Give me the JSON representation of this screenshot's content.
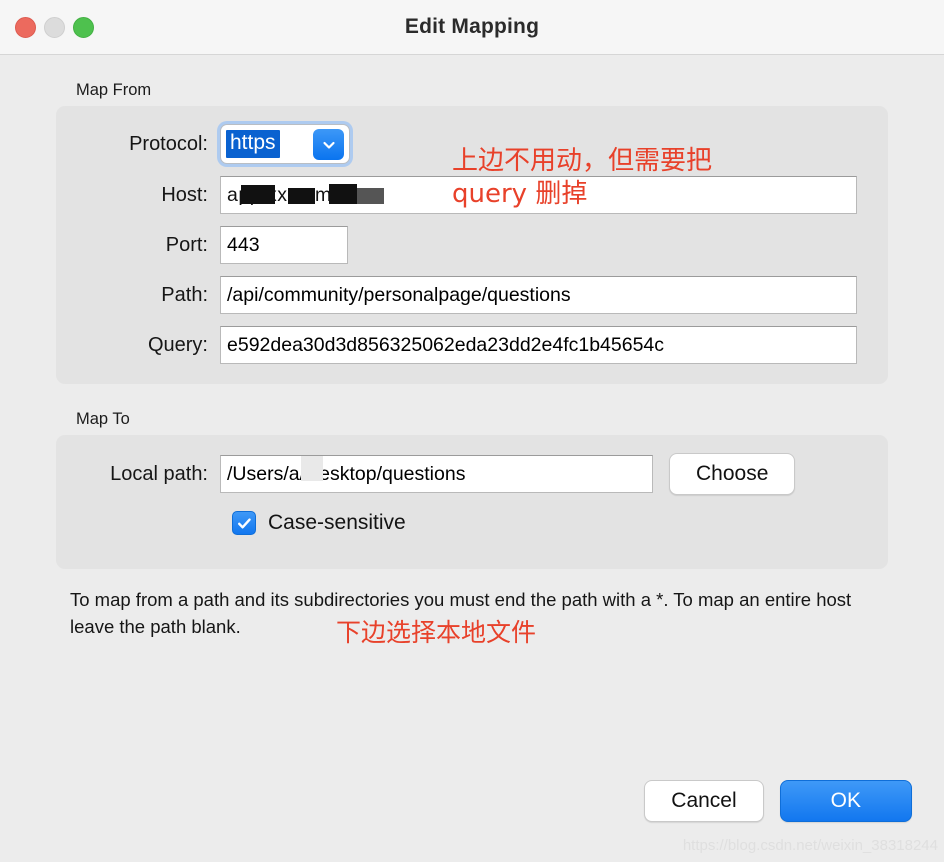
{
  "window": {
    "title": "Edit Mapping",
    "traffic_lights": [
      {
        "name": "close",
        "color": "#ec6a5e"
      },
      {
        "name": "minimize",
        "color": "#dcdcdc"
      },
      {
        "name": "maximize",
        "color": "#4ec14e"
      }
    ]
  },
  "map_from": {
    "group_label": "Map From",
    "protocol": {
      "label": "Protocol:",
      "value": "https",
      "selected": true
    },
    "host": {
      "label": "Host:",
      "value": "app.xx.com.",
      "redacted": true
    },
    "port": {
      "label": "Port:",
      "value": "443"
    },
    "path": {
      "label": "Path:",
      "value": "/api/community/personalpage/questions"
    },
    "query": {
      "label": "Query:",
      "value": "e592dea30d3d856325062eda23dd2e4fc1b45654c"
    }
  },
  "map_to": {
    "group_label": "Map To",
    "local_path": {
      "label": "Local path:",
      "value_before": "/Users/",
      "value_after": "a/Desktop/questions",
      "redacted": true
    },
    "choose_label": "Choose",
    "case_sensitive": {
      "label": "Case-sensitive",
      "checked": true
    }
  },
  "help_text": "To map from a path and its subdirectories you must end the path with a *. To map an entire host leave the path blank.",
  "annotations": [
    {
      "text": "上边不用动，但需要把\nquery 删掉",
      "color": "#e8412a"
    },
    {
      "text": "下边选择本地文件",
      "color": "#e8412a"
    }
  ],
  "footer": {
    "cancel_label": "Cancel",
    "ok_label": "OK"
  },
  "watermark": "https://blog.csdn.net/weixin_38318244",
  "colors": {
    "accent_blue": "#1277ef",
    "annotation_red": "#e8412a",
    "background": "#ececec",
    "group_background": "#e3e3e3"
  }
}
